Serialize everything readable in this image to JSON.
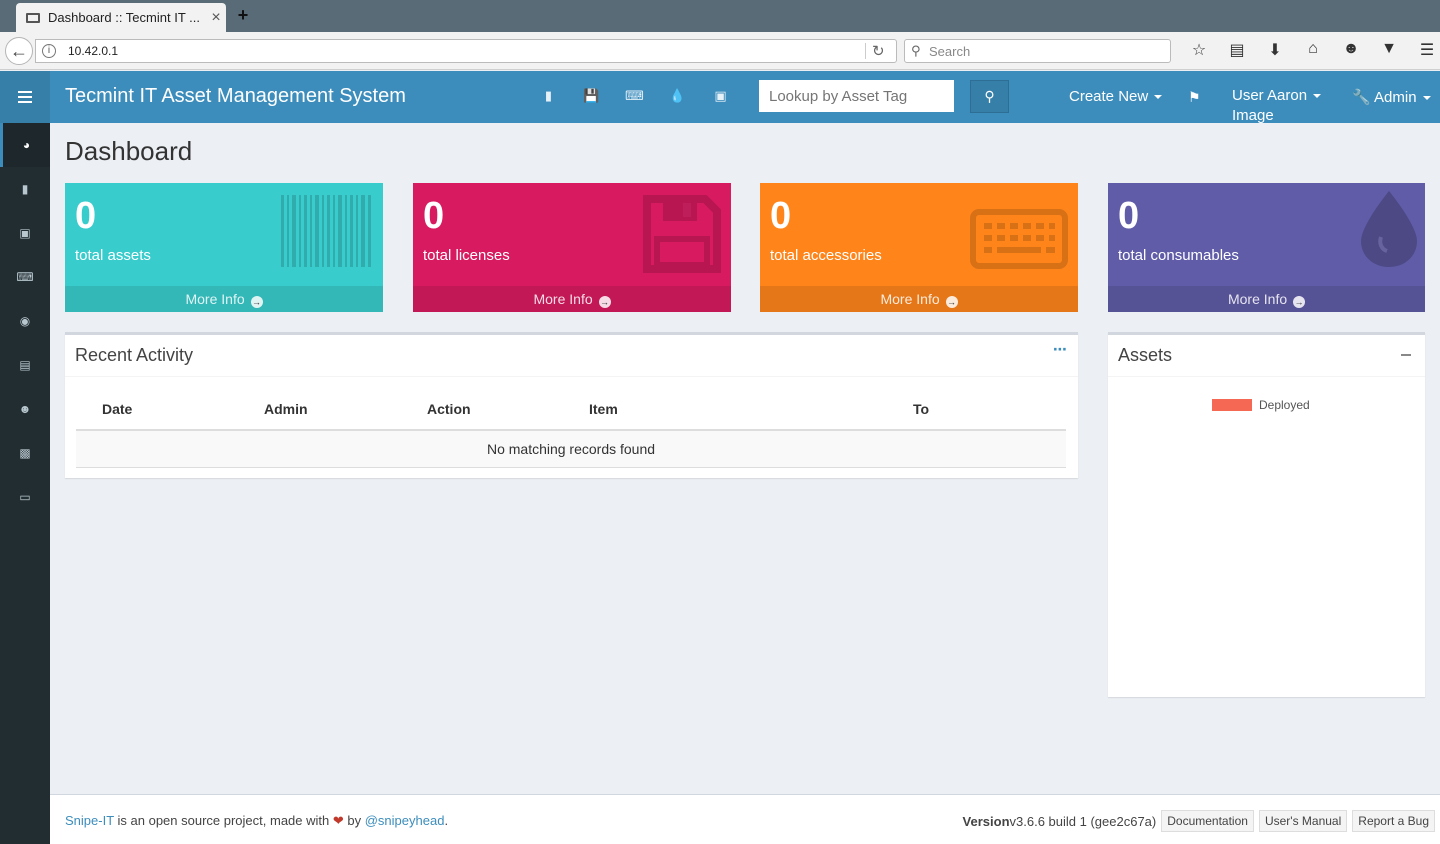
{
  "browser": {
    "tab_title": "Dashboard :: Tecmint IT ...",
    "tab_close": "×",
    "new_tab": "+",
    "url": "10.42.0.1",
    "search_placeholder": "Search"
  },
  "header": {
    "brand": "Tecmint IT Asset Management System",
    "lookup_placeholder": "Lookup by Asset Tag",
    "create_new": "Create New",
    "user_line1": "User Aaron",
    "user_line2": "Image",
    "admin": "Admin"
  },
  "page": {
    "title": "Dashboard"
  },
  "boxes": [
    {
      "count": "0",
      "label": "total assets",
      "more": "More Info",
      "color": "#39cccc"
    },
    {
      "count": "0",
      "label": "total licenses",
      "more": "More Info",
      "color": "#d81b60"
    },
    {
      "count": "0",
      "label": "total accessories",
      "more": "More Info",
      "color": "#ff851b"
    },
    {
      "count": "0",
      "label": "total consumables",
      "more": "More Info",
      "color": "#605ca8"
    }
  ],
  "recent_activity": {
    "title": "Recent Activity",
    "columns": [
      "Date",
      "Admin",
      "Action",
      "Item",
      "To"
    ],
    "empty": "No matching records found"
  },
  "assets_panel": {
    "title": "Assets",
    "legend": "Deployed",
    "legend_color": "#f56954"
  },
  "footer": {
    "brand_link": "Snipe-IT",
    "text1": " is an open source project, made with ",
    "text2": " by ",
    "author_link": "@snipeyhead",
    "period": ".",
    "version_label": "Version",
    "version": " v3.6.6 build 1 (gee2c67a)",
    "documentation": "Documentation",
    "manual": "User's Manual",
    "report": "Report a Bug"
  }
}
